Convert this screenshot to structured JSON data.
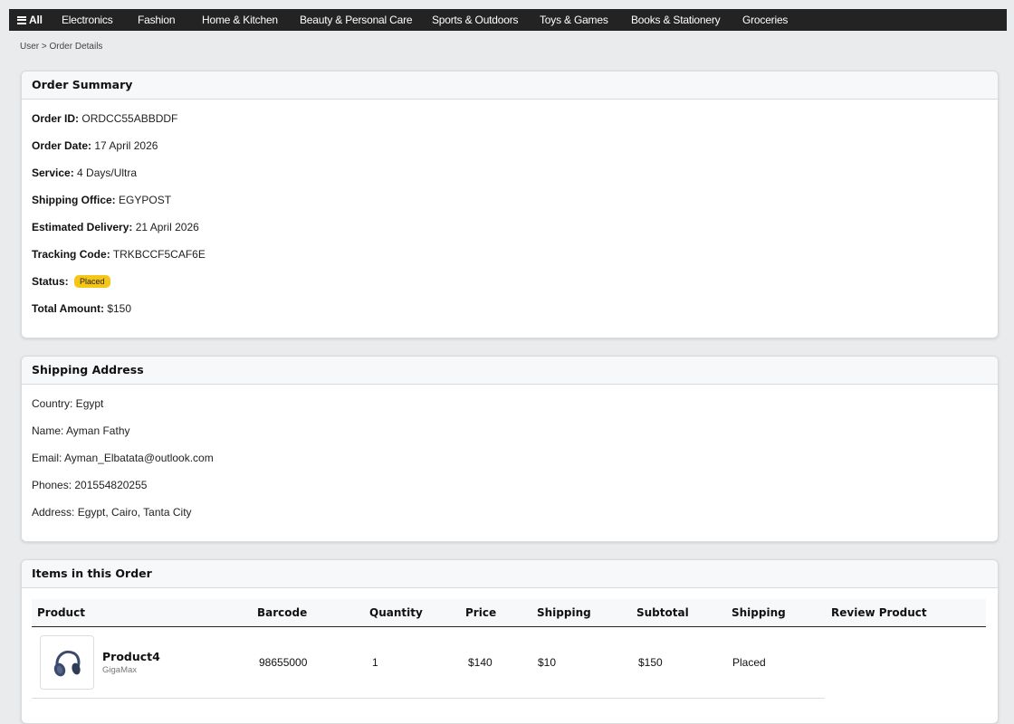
{
  "nav": {
    "all_label": "All",
    "items": [
      "Electronics",
      "Fashion",
      "Home & Kitchen",
      "Beauty & Personal Care",
      "Sports & Outdoors",
      "Toys & Games",
      "Books & Stationery",
      "Groceries"
    ]
  },
  "breadcrumb": "User > Order Details",
  "summary": {
    "title": "Order Summary",
    "order_id_label": "Order ID:",
    "order_id": "ORDCC55ABBDDF",
    "order_date_label": "Order Date:",
    "order_date": "17 April 2026",
    "service_label": "Service:",
    "service": "4 Days/Ultra",
    "shipping_office_label": "Shipping Office:",
    "shipping_office": "EGYPOST",
    "estimated_delivery_label": "Estimated Delivery:",
    "estimated_delivery": "21 April 2026",
    "tracking_code_label": "Tracking Code:",
    "tracking_code": "TRKBCCF5CAF6E",
    "status_label": "Status:",
    "status": "Placed",
    "total_label": "Total Amount:",
    "total": "$150"
  },
  "shipping": {
    "title": "Shipping Address",
    "country": "Country: Egypt",
    "name": "Name: Ayman Fathy",
    "email": "Email: Ayman_Elbatata@outlook.com",
    "phones": "Phones: 201554820255",
    "address": "Address: Egypt, Cairo, Tanta City"
  },
  "items": {
    "title": "Items in this Order",
    "columns": [
      "Product",
      "Barcode",
      "Quantity",
      "Price",
      "Shipping",
      "Subtotal",
      "Shipping",
      "Review Product"
    ],
    "rows": [
      {
        "image_icon": "headphones-icon",
        "name": "Product4",
        "brand": "GigaMax",
        "barcode": "98655000",
        "quantity": "1",
        "price": "$140",
        "shipping": "$10",
        "subtotal": "$150",
        "shipping_status": "Placed"
      }
    ]
  },
  "colors": {
    "nav_bg": "#232323",
    "page_bg": "#eaebed",
    "status_badge": "#f5c518",
    "headphones": "#3b4a6b"
  }
}
